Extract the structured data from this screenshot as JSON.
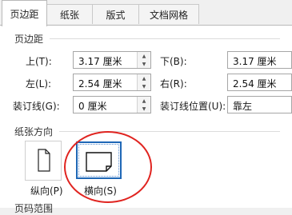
{
  "tabs": [
    {
      "label": "页边距",
      "active": true
    },
    {
      "label": "纸张",
      "active": false
    },
    {
      "label": "版式",
      "active": false
    },
    {
      "label": "文档网格",
      "active": false
    }
  ],
  "margins": {
    "title": "页边距",
    "top": {
      "label": "上(T):",
      "value": "3.17 厘米"
    },
    "bottom": {
      "label": "下(B):",
      "value": "3.17 厘米"
    },
    "left": {
      "label": "左(L):",
      "value": "2.54 厘米"
    },
    "right": {
      "label": "右(R):",
      "value": "2.54 厘米"
    },
    "gutter": {
      "label": "装订线(G):",
      "value": "0 厘米"
    },
    "gutter_position": {
      "label": "装订线位置(U):",
      "value": "靠左"
    }
  },
  "orientation": {
    "title": "纸张方向",
    "portrait": {
      "label": "纵向(P)"
    },
    "landscape": {
      "label": "横向(S)",
      "selected": true
    }
  },
  "page_range": {
    "title": "页码范围"
  },
  "colors": {
    "accent": "#1e67b6",
    "highlight_circle": "#e02420"
  }
}
